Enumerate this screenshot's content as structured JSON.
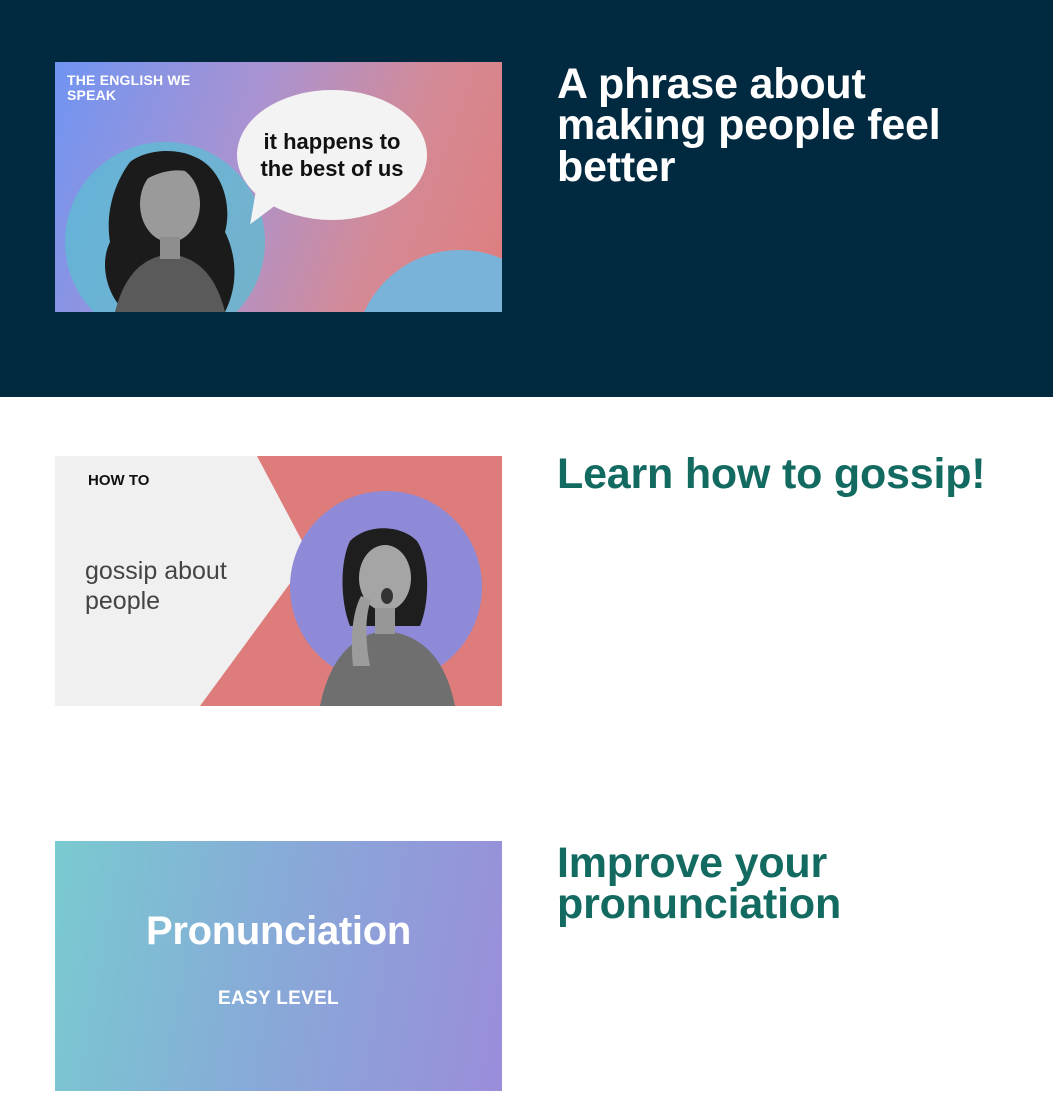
{
  "cards": [
    {
      "headline": "A phrase about making people feel better",
      "thumbnail": {
        "brand": "THE ENGLISH WE SPEAK",
        "bubble": "it happens to the best of us"
      }
    },
    {
      "headline": "Learn how to gossip!",
      "thumbnail": {
        "kicker": "HOW TO",
        "title": "gossip about people"
      }
    },
    {
      "headline": "Improve your pronunciation",
      "thumbnail": {
        "title": "Pronunciation",
        "subtitle": "EASY LEVEL"
      }
    }
  ],
  "colors": {
    "featured_bg": "#01293f",
    "headline_teal": "#136a61",
    "accent_coral": "#dd7f80",
    "accent_blue": "#7db5d6"
  }
}
